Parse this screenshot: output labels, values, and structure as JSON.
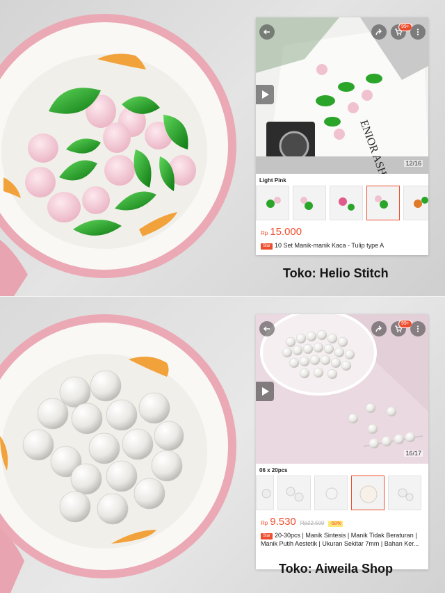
{
  "listings": [
    {
      "variant_label": "Light Pink",
      "page_counter": "12/16",
      "cart_badge": "99+",
      "currency": "Rp",
      "price": "15.000",
      "old_price": "",
      "discount": "",
      "star_badge": "Star",
      "product_title": "10 Set Manik-manik Kaca - Tulip type A",
      "shop_caption": "Toko: Helio Stitch",
      "hero_print_text": "ENIOR ASH"
    },
    {
      "variant_label": "06 x 20pcs",
      "page_counter": "16/17",
      "cart_badge": "99+",
      "currency": "Rp",
      "price": "9.530",
      "old_price": "Rp22.500",
      "discount": "-58%",
      "star_badge": "Star",
      "product_title": "20-30pcs | Manik Sintesis | Manik Tidak Beraturan | Manik Putih Aestetik | Ukuran Sekitar 7mm | Bahan Ker...",
      "shop_caption": "Toko: Aiweila Shop"
    }
  ],
  "colors": {
    "accent": "#ee4d2d",
    "bowl_rim": "#e9a9b4",
    "bowl_inner": "#f4f2ee",
    "green_bead": "#1f9e1f",
    "pink_bead": "#f2c6d3",
    "pearl": "#ecebe8"
  },
  "icons": [
    "back-arrow-icon",
    "share-icon",
    "cart-icon",
    "more-icon",
    "play-icon"
  ]
}
